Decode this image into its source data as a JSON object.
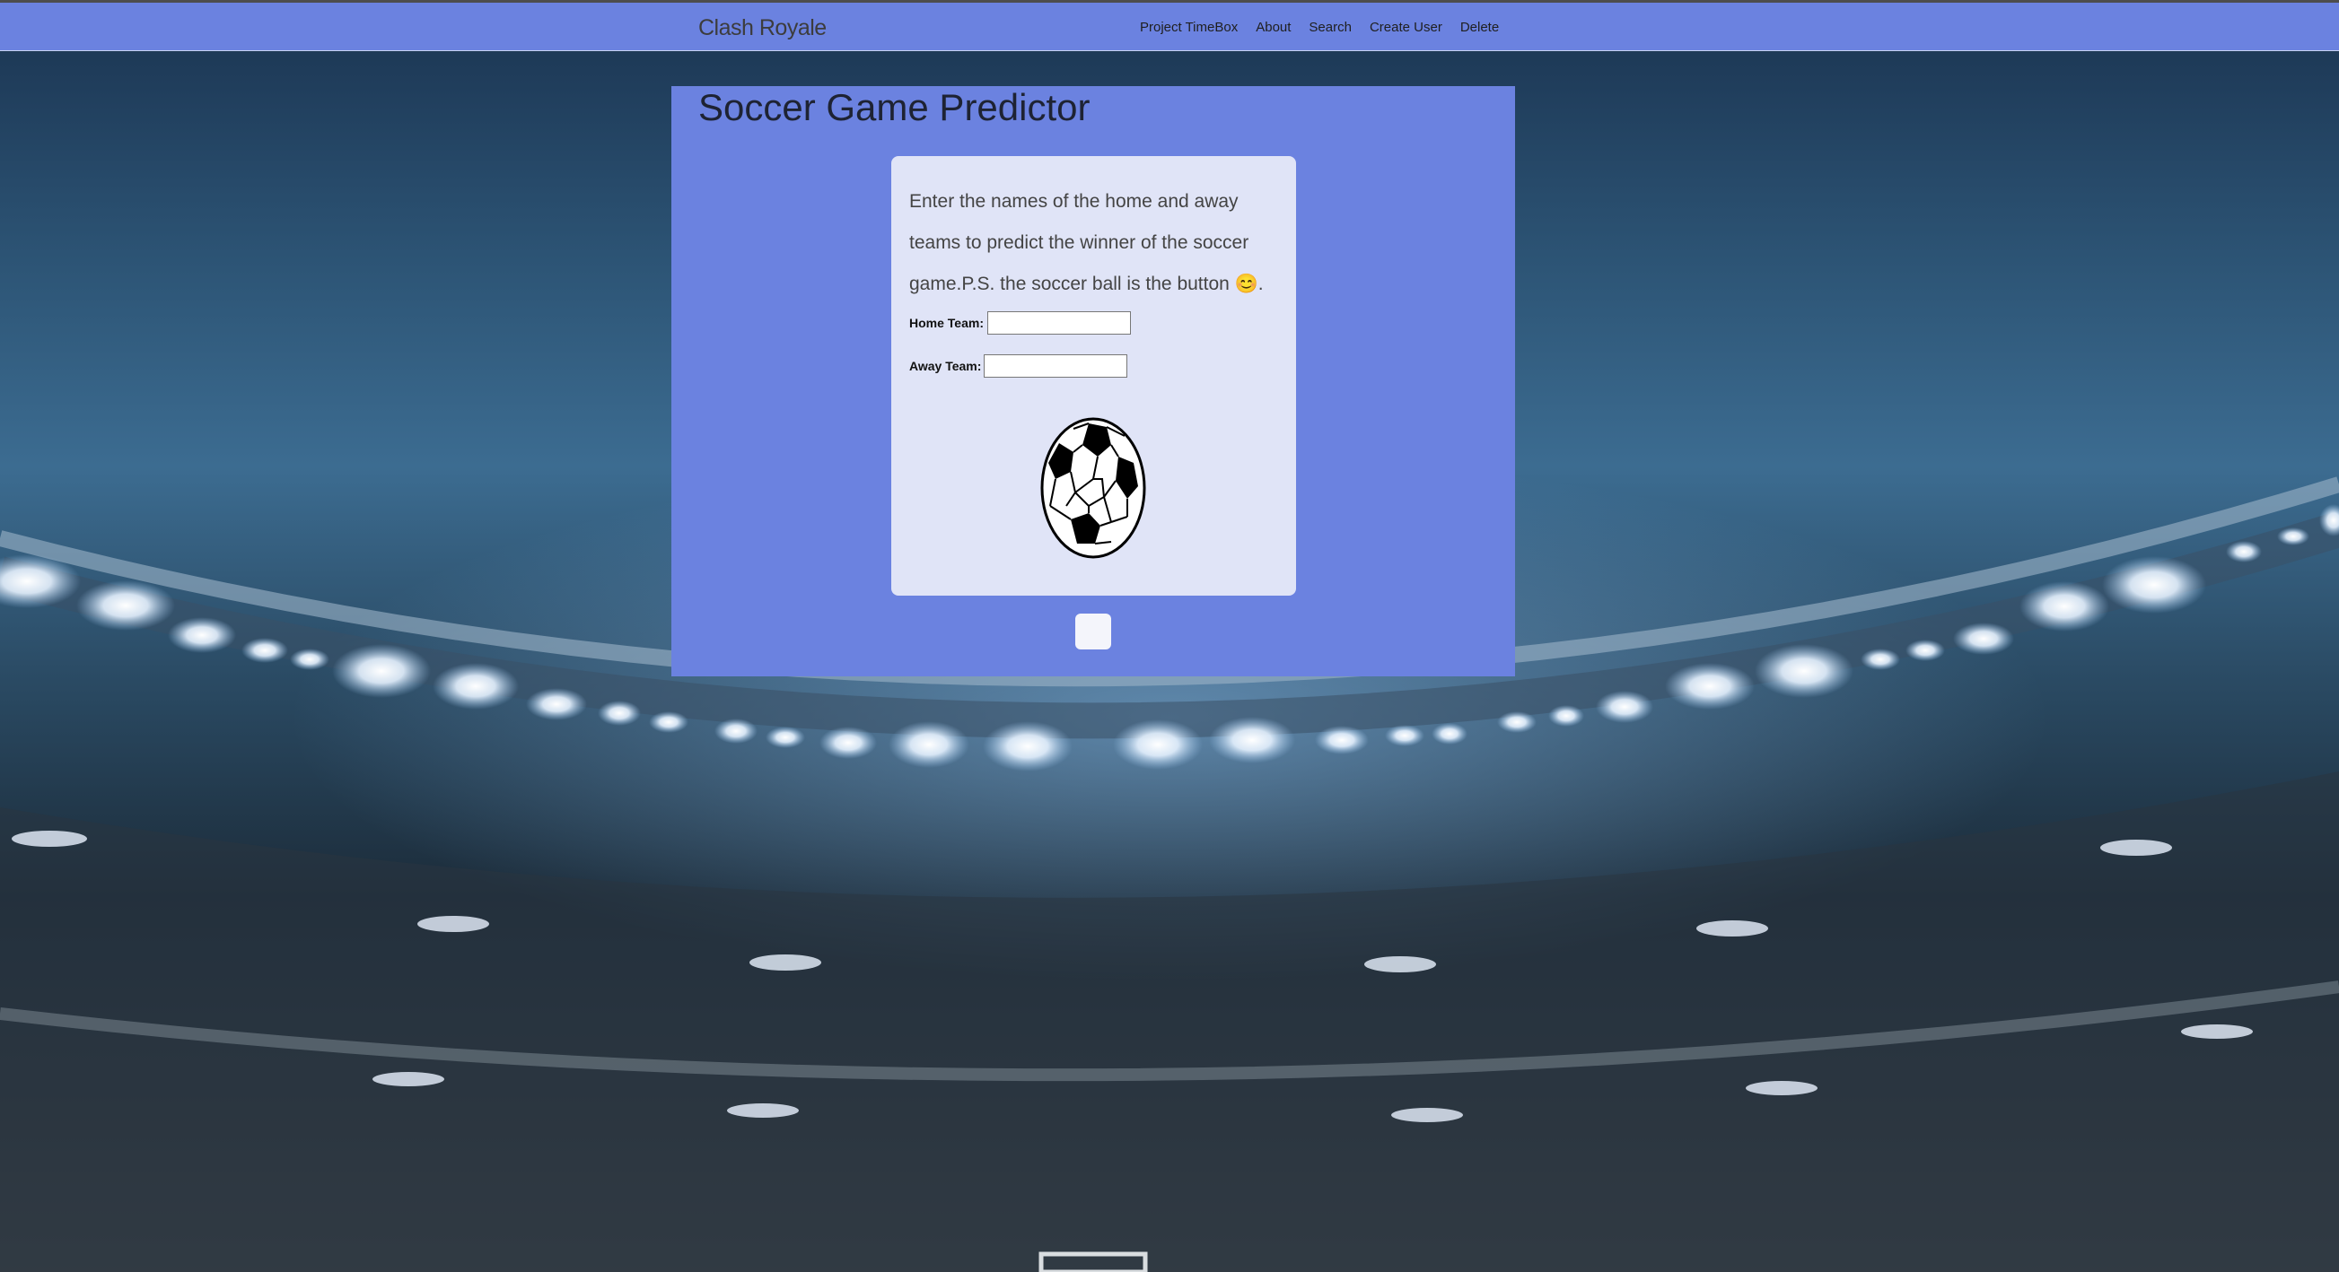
{
  "navbar": {
    "brand": "Clash Royale",
    "links": [
      "Project TimeBox",
      "About",
      "Search",
      "Create User",
      "Delete"
    ]
  },
  "main": {
    "title": "Soccer Game Predictor",
    "intro": "Enter the names of the home and away teams to predict the winner of the soccer game.P.S. the soccer ball is the button 😊.",
    "home_label": "Home Team:",
    "home_value": "",
    "away_label": "Away Team:",
    "away_value": "",
    "ball_icon": "soccer-ball-icon",
    "submit_label": ""
  },
  "colors": {
    "accent": "#6b82e0",
    "card": "#e0e4f7"
  }
}
